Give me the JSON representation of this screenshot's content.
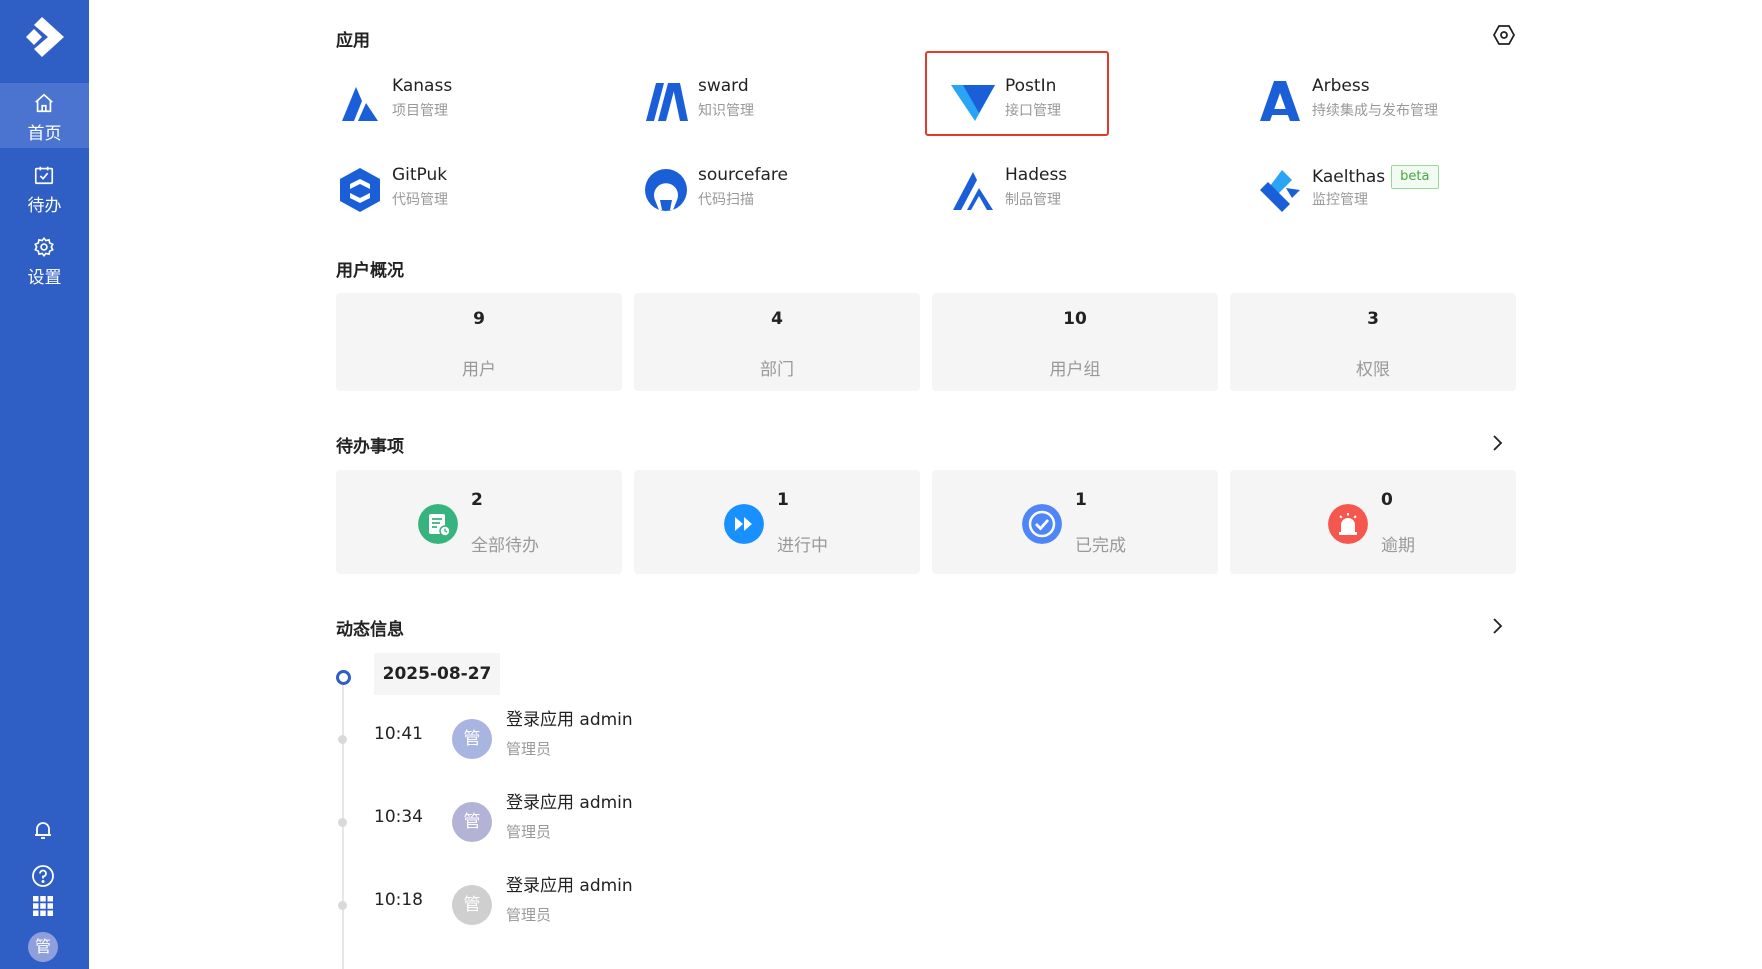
{
  "sidebar": {
    "nav": [
      {
        "label": "首页",
        "icon": "home-icon"
      },
      {
        "label": "待办",
        "icon": "calendar-check-icon"
      },
      {
        "label": "设置",
        "icon": "gear-icon"
      }
    ],
    "avatar_text": "管",
    "bottom_icons": [
      "bell-icon",
      "help-icon",
      "apps-grid-icon"
    ]
  },
  "apps": {
    "title": "应用",
    "items": [
      {
        "name": "Kanass",
        "desc": "项目管理"
      },
      {
        "name": "sward",
        "desc": "知识管理"
      },
      {
        "name": "PostIn",
        "desc": "接口管理"
      },
      {
        "name": "Arbess",
        "desc": "持续集成与发布管理"
      },
      {
        "name": "GitPuk",
        "desc": "代码管理"
      },
      {
        "name": "sourcefare",
        "desc": "代码扫描"
      },
      {
        "name": "Hadess",
        "desc": "制品管理"
      },
      {
        "name": "Kaelthas",
        "desc": "监控管理",
        "badge": "beta"
      }
    ]
  },
  "users": {
    "title": "用户概况",
    "stats": [
      {
        "value": "9",
        "label": "用户"
      },
      {
        "value": "4",
        "label": "部门"
      },
      {
        "value": "10",
        "label": "用户组"
      },
      {
        "value": "3",
        "label": "权限"
      }
    ]
  },
  "todos": {
    "title": "待办事项",
    "items": [
      {
        "value": "2",
        "label": "全部待办",
        "color": "#36b37e"
      },
      {
        "value": "1",
        "label": "进行中",
        "color": "#1890ff"
      },
      {
        "value": "1",
        "label": "已完成",
        "color": "#4f86f7"
      },
      {
        "value": "0",
        "label": "逾期",
        "color": "#f5564e"
      }
    ]
  },
  "activity": {
    "title": "动态信息",
    "date": "2025-08-27",
    "items": [
      {
        "time": "10:41",
        "avatar": "管",
        "title": "登录应用 admin",
        "sub": "管理员",
        "avatar_color": "#a8b5e0"
      },
      {
        "time": "10:34",
        "avatar": "管",
        "title": "登录应用 admin",
        "sub": "管理员",
        "avatar_color": "#b3b3d6"
      },
      {
        "time": "10:18",
        "avatar": "管",
        "title": "登录应用 admin",
        "sub": "管理员",
        "avatar_color": "#cfcfcf"
      }
    ]
  },
  "colors": {
    "sidebar": "#2f5ec4",
    "accent": "#1565d8",
    "highlight": "#e53a2a"
  }
}
